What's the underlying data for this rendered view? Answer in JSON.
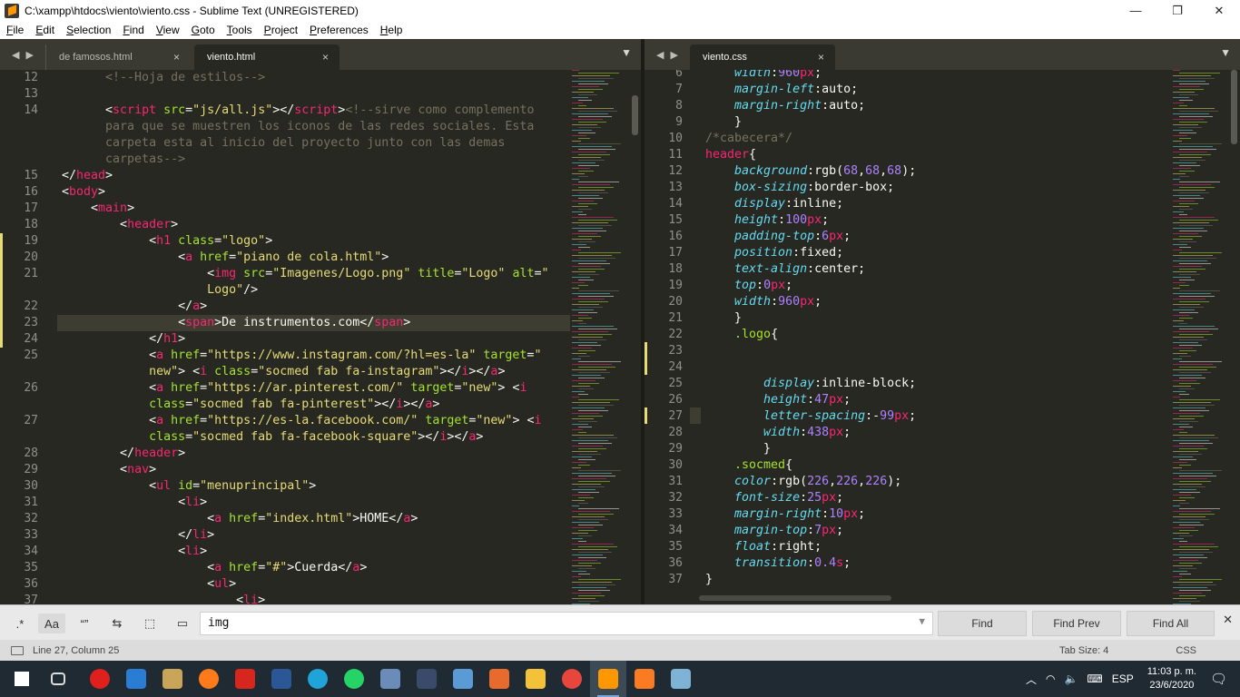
{
  "window": {
    "title": "C:\\xampp\\htdocs\\viento\\viento.css - Sublime Text (UNREGISTERED)",
    "min": "—",
    "max": "❐",
    "close": "✕"
  },
  "menu": [
    "File",
    "Edit",
    "Selection",
    "Find",
    "View",
    "Goto",
    "Tools",
    "Project",
    "Preferences",
    "Help"
  ],
  "left_pane": {
    "tabs": [
      {
        "label": "de famosos.html",
        "active": false
      },
      {
        "label": "viento.html",
        "active": true
      }
    ],
    "gutter": [
      "12",
      "13",
      "14",
      "",
      "",
      "",
      "15",
      "16",
      "17",
      "18",
      "19",
      "20",
      "21",
      "",
      "22",
      "23",
      "24",
      "25",
      "",
      "26",
      "",
      "27",
      "",
      "28",
      "29",
      "30",
      "31",
      "32",
      "33",
      "34",
      "35",
      "36",
      "37"
    ],
    "lines": [
      [
        [
          "c",
          "      <!--Hoja de estilos-->"
        ]
      ],
      [],
      [
        [
          "w",
          "      <"
        ],
        [
          "t",
          "script"
        ],
        [
          "w",
          " "
        ],
        [
          "a",
          "src"
        ],
        [
          "w",
          "="
        ],
        [
          "s",
          "\"js/all.js\""
        ],
        [
          "w",
          "></"
        ],
        [
          "t",
          "script"
        ],
        [
          "w",
          ">"
        ],
        [
          "c",
          "<!--sirve como complemento"
        ]
      ],
      [
        [
          "c",
          "      para que se muestren los iconos de las redes sociales. Esta"
        ]
      ],
      [
        [
          "c",
          "      carpeta esta al inicio del proyecto junto con las demas"
        ]
      ],
      [
        [
          "c",
          "      carpetas-->"
        ]
      ],
      [
        [
          "w",
          "</"
        ],
        [
          "t",
          "head"
        ],
        [
          "w",
          ">"
        ]
      ],
      [
        [
          "w",
          "<"
        ],
        [
          "t",
          "body"
        ],
        [
          "w",
          ">"
        ]
      ],
      [
        [
          "w",
          "    <"
        ],
        [
          "t",
          "main"
        ],
        [
          "w",
          ">"
        ]
      ],
      [
        [
          "w",
          "        <"
        ],
        [
          "t",
          "header"
        ],
        [
          "w",
          ">"
        ]
      ],
      [
        [
          "w",
          "            <"
        ],
        [
          "t",
          "h1"
        ],
        [
          "w",
          " "
        ],
        [
          "a",
          "class"
        ],
        [
          "w",
          "="
        ],
        [
          "s",
          "\"logo\""
        ],
        [
          "w",
          ">"
        ]
      ],
      [
        [
          "w",
          "                <"
        ],
        [
          "t",
          "a"
        ],
        [
          "w",
          " "
        ],
        [
          "a",
          "href"
        ],
        [
          "w",
          "="
        ],
        [
          "s",
          "\"piano de cola.html\""
        ],
        [
          "w",
          ">"
        ]
      ],
      [
        [
          "w",
          "                    <"
        ],
        [
          "t",
          "img"
        ],
        [
          "w",
          " "
        ],
        [
          "a",
          "src"
        ],
        [
          "w",
          "="
        ],
        [
          "s",
          "\"Imagenes/Logo.png\""
        ],
        [
          "w",
          " "
        ],
        [
          "a",
          "title"
        ],
        [
          "w",
          "="
        ],
        [
          "s",
          "\"Logo\""
        ],
        [
          "w",
          " "
        ],
        [
          "a",
          "alt"
        ],
        [
          "w",
          "="
        ],
        [
          "s",
          "\""
        ]
      ],
      [
        [
          "s",
          "                    Logo\""
        ],
        [
          "w",
          "/>"
        ]
      ],
      [
        [
          "w",
          "                </"
        ],
        [
          "t",
          "a"
        ],
        [
          "w",
          ">"
        ]
      ],
      [
        [
          "w",
          "                <"
        ],
        [
          "t",
          "span"
        ],
        [
          "w",
          ">De instrumentos.com</"
        ],
        [
          "t",
          "span"
        ],
        [
          "w",
          ">"
        ]
      ],
      [
        [
          "w",
          "            </"
        ],
        [
          "t",
          "h1"
        ],
        [
          "w",
          ">"
        ]
      ],
      [
        [
          "w",
          "            <"
        ],
        [
          "t",
          "a"
        ],
        [
          "w",
          " "
        ],
        [
          "a",
          "href"
        ],
        [
          "w",
          "="
        ],
        [
          "s",
          "\"https://www.instagram.com/?hl=es-la\""
        ],
        [
          "w",
          " "
        ],
        [
          "a",
          "target"
        ],
        [
          "w",
          "="
        ],
        [
          "s",
          "\""
        ]
      ],
      [
        [
          "s",
          "            new\""
        ],
        [
          "w",
          "> <"
        ],
        [
          "t",
          "i"
        ],
        [
          "w",
          " "
        ],
        [
          "a",
          "class"
        ],
        [
          "w",
          "="
        ],
        [
          "s",
          "\"socmed fab fa-instagram\""
        ],
        [
          "w",
          "></"
        ],
        [
          "t",
          "i"
        ],
        [
          "w",
          "></"
        ],
        [
          "t",
          "a"
        ],
        [
          "w",
          ">"
        ]
      ],
      [
        [
          "w",
          "            <"
        ],
        [
          "t",
          "a"
        ],
        [
          "w",
          " "
        ],
        [
          "a",
          "href"
        ],
        [
          "w",
          "="
        ],
        [
          "s",
          "\"https://ar.pinterest.com/\""
        ],
        [
          "w",
          " "
        ],
        [
          "a",
          "target"
        ],
        [
          "w",
          "="
        ],
        [
          "s",
          "\"new\""
        ],
        [
          "w",
          "> <"
        ],
        [
          "t",
          "i"
        ]
      ],
      [
        [
          "w",
          "            "
        ],
        [
          "a",
          "class"
        ],
        [
          "w",
          "="
        ],
        [
          "s",
          "\"socmed fab fa-pinterest\""
        ],
        [
          "w",
          "></"
        ],
        [
          "t",
          "i"
        ],
        [
          "w",
          "></"
        ],
        [
          "t",
          "a"
        ],
        [
          "w",
          ">"
        ]
      ],
      [
        [
          "w",
          "            <"
        ],
        [
          "t",
          "a"
        ],
        [
          "w",
          " "
        ],
        [
          "a",
          "href"
        ],
        [
          "w",
          "="
        ],
        [
          "s",
          "\"https://es-la.facebook.com/\""
        ],
        [
          "w",
          " "
        ],
        [
          "a",
          "target"
        ],
        [
          "w",
          "="
        ],
        [
          "s",
          "\"new\""
        ],
        [
          "w",
          "> <"
        ],
        [
          "t",
          "i"
        ]
      ],
      [
        [
          "w",
          "            "
        ],
        [
          "a",
          "class"
        ],
        [
          "w",
          "="
        ],
        [
          "s",
          "\"socmed fab fa-facebook-square\""
        ],
        [
          "w",
          "></"
        ],
        [
          "t",
          "i"
        ],
        [
          "w",
          "></"
        ],
        [
          "t",
          "a"
        ],
        [
          "w",
          ">"
        ]
      ],
      [
        [
          "w",
          "        </"
        ],
        [
          "t",
          "header"
        ],
        [
          "w",
          ">"
        ]
      ],
      [
        [
          "w",
          "        <"
        ],
        [
          "t",
          "nav"
        ],
        [
          "w",
          ">"
        ]
      ],
      [
        [
          "w",
          "            <"
        ],
        [
          "t",
          "ul"
        ],
        [
          "w",
          " "
        ],
        [
          "a",
          "id"
        ],
        [
          "w",
          "="
        ],
        [
          "s",
          "\"menuprincipal\""
        ],
        [
          "w",
          ">"
        ]
      ],
      [
        [
          "w",
          "                <"
        ],
        [
          "t",
          "li"
        ],
        [
          "w",
          ">"
        ]
      ],
      [
        [
          "w",
          "                    <"
        ],
        [
          "t",
          "a"
        ],
        [
          "w",
          " "
        ],
        [
          "a",
          "href"
        ],
        [
          "w",
          "="
        ],
        [
          "s",
          "\"index.html\""
        ],
        [
          "w",
          ">HOME</"
        ],
        [
          "t",
          "a"
        ],
        [
          "w",
          ">"
        ]
      ],
      [
        [
          "w",
          "                </"
        ],
        [
          "t",
          "li"
        ],
        [
          "w",
          ">"
        ]
      ],
      [
        [
          "w",
          "                <"
        ],
        [
          "t",
          "li"
        ],
        [
          "w",
          ">"
        ]
      ],
      [
        [
          "w",
          "                    <"
        ],
        [
          "t",
          "a"
        ],
        [
          "w",
          " "
        ],
        [
          "a",
          "href"
        ],
        [
          "w",
          "="
        ],
        [
          "s",
          "\"#\""
        ],
        [
          "w",
          ">Cuerda</"
        ],
        [
          "t",
          "a"
        ],
        [
          "w",
          ">"
        ]
      ],
      [
        [
          "w",
          "                    <"
        ],
        [
          "t",
          "ul"
        ],
        [
          "w",
          ">"
        ]
      ],
      [
        [
          "w",
          "                        <"
        ],
        [
          "t",
          "li"
        ],
        [
          "w",
          ">"
        ]
      ]
    ]
  },
  "right_pane": {
    "tabs": [
      {
        "label": "viento.css",
        "active": true
      }
    ],
    "gutter": [
      "6",
      "7",
      "8",
      "9",
      "10",
      "11",
      "12",
      "13",
      "14",
      "15",
      "16",
      "17",
      "18",
      "19",
      "20",
      "21",
      "22",
      "23",
      "24",
      "25",
      "26",
      "27",
      "28",
      "29",
      "30",
      "31",
      "32",
      "33",
      "34",
      "35",
      "36",
      "37",
      ""
    ],
    "lines": [
      [
        [
          "p",
          "    width"
        ],
        [
          "w",
          ":"
        ],
        [
          "n",
          "960"
        ],
        [
          "t",
          "px"
        ],
        [
          "w",
          ";"
        ]
      ],
      [
        [
          "p",
          "    margin-left"
        ],
        [
          "w",
          ":auto;"
        ]
      ],
      [
        [
          "p",
          "    margin-right"
        ],
        [
          "w",
          ":auto;"
        ]
      ],
      [
        [
          "w",
          "    }"
        ]
      ],
      [
        [
          "c",
          "/*cabecera*/"
        ]
      ],
      [
        [
          "t",
          "header"
        ],
        [
          "w",
          "{"
        ]
      ],
      [
        [
          "p",
          "    background"
        ],
        [
          "w",
          ":rgb("
        ],
        [
          "n",
          "68"
        ],
        [
          "w",
          ","
        ],
        [
          "n",
          "68"
        ],
        [
          "w",
          ","
        ],
        [
          "n",
          "68"
        ],
        [
          "w",
          ");"
        ]
      ],
      [
        [
          "p",
          "    box-sizing"
        ],
        [
          "w",
          ":border-box;"
        ]
      ],
      [
        [
          "p",
          "    display"
        ],
        [
          "w",
          ":inline;"
        ]
      ],
      [
        [
          "p",
          "    height"
        ],
        [
          "w",
          ":"
        ],
        [
          "n",
          "100"
        ],
        [
          "t",
          "px"
        ],
        [
          "w",
          ";"
        ]
      ],
      [
        [
          "p",
          "    padding-top"
        ],
        [
          "w",
          ":"
        ],
        [
          "n",
          "6"
        ],
        [
          "t",
          "px"
        ],
        [
          "w",
          ";"
        ]
      ],
      [
        [
          "p",
          "    position"
        ],
        [
          "w",
          ":fixed;"
        ]
      ],
      [
        [
          "p",
          "    text-align"
        ],
        [
          "w",
          ":center;"
        ]
      ],
      [
        [
          "p",
          "    top"
        ],
        [
          "w",
          ":"
        ],
        [
          "n",
          "0"
        ],
        [
          "t",
          "px"
        ],
        [
          "w",
          ";"
        ]
      ],
      [
        [
          "p",
          "    width"
        ],
        [
          "w",
          ":"
        ],
        [
          "n",
          "960"
        ],
        [
          "t",
          "px"
        ],
        [
          "w",
          ";"
        ]
      ],
      [
        [
          "w",
          "    }"
        ]
      ],
      [
        [
          "a",
          "    .logo"
        ],
        [
          "w",
          "{"
        ]
      ],
      [],
      [],
      [
        [
          "p",
          "        display"
        ],
        [
          "w",
          ":inline-block;"
        ]
      ],
      [
        [
          "p",
          "        height"
        ],
        [
          "w",
          ":"
        ],
        [
          "n",
          "47"
        ],
        [
          "t",
          "px"
        ],
        [
          "w",
          ";"
        ]
      ],
      [
        [
          "p",
          "        letter-spacing"
        ],
        [
          "w",
          ":-"
        ],
        [
          "n",
          "99"
        ],
        [
          "t",
          "px"
        ],
        [
          "w",
          ";"
        ]
      ],
      [
        [
          "p",
          "        width"
        ],
        [
          "w",
          ":"
        ],
        [
          "n",
          "438"
        ],
        [
          "t",
          "px"
        ],
        [
          "w",
          ";"
        ]
      ],
      [
        [
          "w",
          "        }"
        ]
      ],
      [
        [
          "a",
          "    .socmed"
        ],
        [
          "w",
          "{"
        ]
      ],
      [
        [
          "p",
          "    color"
        ],
        [
          "w",
          ":rgb("
        ],
        [
          "n",
          "226"
        ],
        [
          "w",
          ","
        ],
        [
          "n",
          "226"
        ],
        [
          "w",
          ","
        ],
        [
          "n",
          "226"
        ],
        [
          "w",
          ");"
        ]
      ],
      [
        [
          "p",
          "    font-size"
        ],
        [
          "w",
          ":"
        ],
        [
          "n",
          "25"
        ],
        [
          "t",
          "px"
        ],
        [
          "w",
          ";"
        ]
      ],
      [
        [
          "p",
          "    margin-right"
        ],
        [
          "w",
          ":"
        ],
        [
          "n",
          "10"
        ],
        [
          "t",
          "px"
        ],
        [
          "w",
          ";"
        ]
      ],
      [
        [
          "p",
          "    margin-top"
        ],
        [
          "w",
          ":"
        ],
        [
          "n",
          "7"
        ],
        [
          "t",
          "px"
        ],
        [
          "w",
          ";"
        ]
      ],
      [
        [
          "p",
          "    float"
        ],
        [
          "w",
          ":right;"
        ]
      ],
      [
        [
          "p",
          "    transition"
        ],
        [
          "w",
          ":"
        ],
        [
          "n",
          "0.4"
        ],
        [
          "t",
          "s"
        ],
        [
          "w",
          ";"
        ]
      ],
      [
        [
          "w",
          "}"
        ]
      ],
      []
    ]
  },
  "find": {
    "regex": ".*",
    "case": "Aa",
    "word": "“”",
    "wrap": "⇆",
    "insel": "⬚",
    "highlight": "▭",
    "query": "img",
    "find": "Find",
    "prev": "Find Prev",
    "all": "Find All",
    "close": "✕"
  },
  "status": {
    "position": "Line 27, Column 25",
    "tabsize": "Tab Size: 4",
    "syntax": "CSS"
  },
  "tray": {
    "time": "11:03 p. m.",
    "date": "23/6/2020",
    "lang": "ESP"
  },
  "taskbar_icons": [
    {
      "name": "start-icon",
      "color": "#ffffff"
    },
    {
      "name": "task-view-icon",
      "color": "#dddddd"
    },
    {
      "name": "opera-icon",
      "color": "#e0201d"
    },
    {
      "name": "mail-icon",
      "color": "#2b7cd3"
    },
    {
      "name": "paint-icon",
      "color": "#c9a55a"
    },
    {
      "name": "firefox-icon",
      "color": "#ff7a1a"
    },
    {
      "name": "acrobat-icon",
      "color": "#d7261d"
    },
    {
      "name": "word-icon",
      "color": "#2b5797"
    },
    {
      "name": "edge-icon",
      "color": "#1fa3d8"
    },
    {
      "name": "whatsapp-icon",
      "color": "#25d366"
    },
    {
      "name": "xampp-tool-icon",
      "color": "#6b8bb8"
    },
    {
      "name": "wamp-icon",
      "color": "#3a4a6a"
    },
    {
      "name": "git-gui-icon",
      "color": "#5b9bd5"
    },
    {
      "name": "git-extensions-icon",
      "color": "#e86a2c"
    },
    {
      "name": "file-explorer-icon",
      "color": "#f3c13a"
    },
    {
      "name": "chrome-icon",
      "color": "#e8453c"
    },
    {
      "name": "sublime-icon",
      "color": "#ff9800"
    },
    {
      "name": "xampp-icon",
      "color": "#fb7a24"
    },
    {
      "name": "notepad-icon",
      "color": "#7fb3d5"
    }
  ]
}
